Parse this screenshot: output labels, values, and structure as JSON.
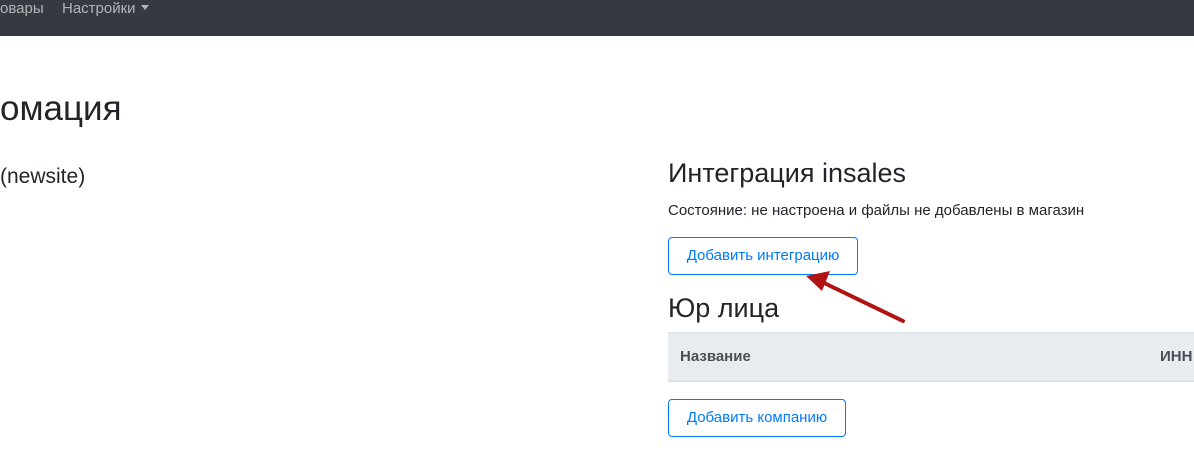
{
  "navbar": {
    "items": [
      {
        "label": "овары"
      },
      {
        "label": "Настройки"
      }
    ]
  },
  "page": {
    "title": "омация",
    "store_name": "(newsite)"
  },
  "integration": {
    "title": "Интеграция insales",
    "status": "Состояние: не настроена и файлы не добавлены в магазин",
    "add_button_label": "Добавить интеграцию"
  },
  "legal_entities": {
    "title": "Юр лица",
    "columns": [
      "Название",
      "ИНН"
    ],
    "add_button_label": "Добавить компанию"
  },
  "annotation": {
    "arrow_color": "#b01414"
  }
}
